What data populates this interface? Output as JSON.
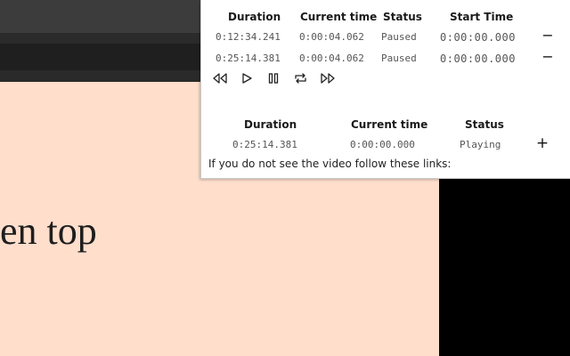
{
  "video": {
    "caption_fragment": "ven top"
  },
  "panel": {
    "table1": {
      "headers": {
        "duration": "Duration",
        "current_time": "Current time",
        "status": "Status",
        "start_time": "Start Time"
      },
      "rows": [
        {
          "duration": "0:12:34.241",
          "current_time": "0:00:04.062",
          "status": "Paused",
          "start_time": "0:00:00.000",
          "action": "−"
        },
        {
          "duration": "0:25:14.381",
          "current_time": "0:00:04.062",
          "status": "Paused",
          "start_time": "0:00:00.000",
          "action": "−"
        }
      ]
    },
    "controls": [
      "rewind-icon",
      "play-icon",
      "pause-icon",
      "loop-icon",
      "fast-forward-icon"
    ],
    "table2": {
      "headers": {
        "duration": "Duration",
        "current_time": "Current time",
        "status": "Status"
      },
      "rows": [
        {
          "duration": "0:25:14.381",
          "current_time": "0:00:00.000",
          "status": "Playing",
          "action": "+"
        }
      ]
    },
    "note": "If you do not see the video follow these links:"
  }
}
